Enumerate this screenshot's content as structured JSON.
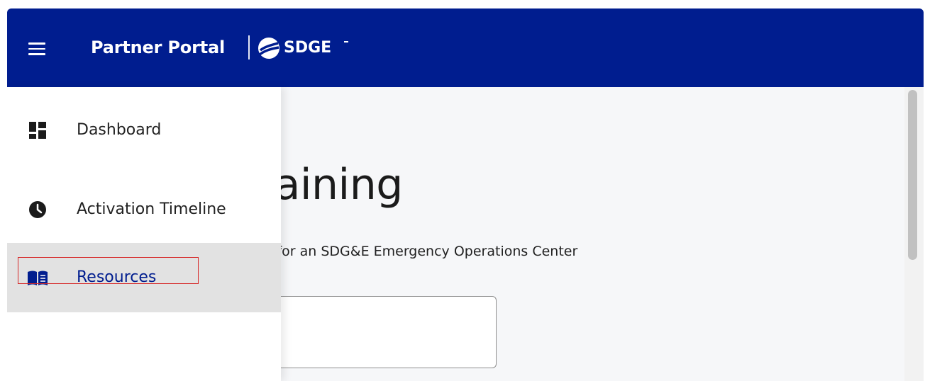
{
  "header": {
    "title": "Partner Portal",
    "logo_text": "SDGE",
    "brand_color": "#001d8f",
    "menu_icon": "hamburger-menu-icon"
  },
  "page": {
    "heading_visible": "ces & Training",
    "description_visible": "ng materials to prepare for an SDG&E Emergency Operations Center",
    "search_value": ""
  },
  "sidebar": {
    "items": [
      {
        "label": "Dashboard",
        "icon": "dashboard-icon",
        "active": false
      },
      {
        "label": "Activation Timeline",
        "icon": "clock-icon",
        "active": false
      },
      {
        "label": "Resources",
        "icon": "book-icon",
        "active": true
      }
    ]
  },
  "annotation": {
    "highlight_color": "#d62828"
  }
}
